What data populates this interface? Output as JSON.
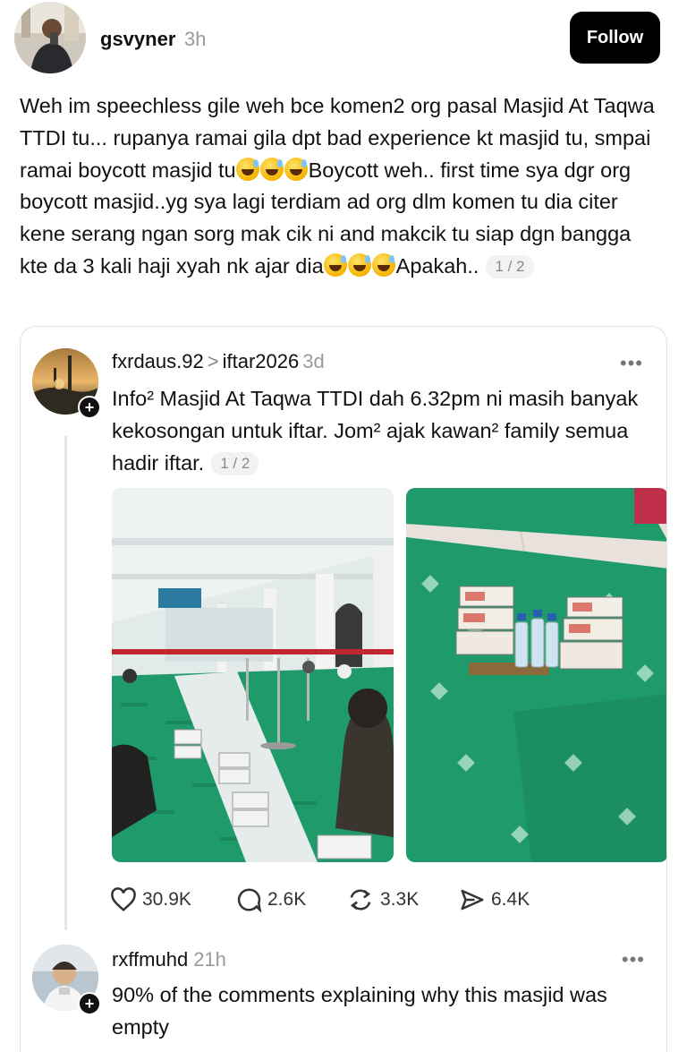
{
  "post": {
    "username": "gsvyner",
    "time": "3h",
    "follow_label": "Follow",
    "text_part1": "Weh im speechless gile weh bce komen2 org pasal Masjid At Taqwa TTDI tu... rupanya ramai gila dpt bad experience kt masjid tu, smpai ramai boycott masjid tu",
    "text_part2": "Boycott weh.. first time sya dgr org boycott masjid..yg sya lagi terdiam ad org dlm komen tu dia citer kene serang ngan sorg mak cik ni and makcik tu siap dgn bangga kte da 3 kali haji xyah nk ajar dia",
    "text_part3": "Apakah..",
    "page_indicator": "1 / 2",
    "emoji_name": "grinning-sweat-emoji"
  },
  "quoted": {
    "username": "fxrdaus.92",
    "arrow": ">",
    "topic": "iftar2026",
    "time": "3d",
    "more": "•••",
    "text": "Info² Masjid At Taqwa TTDI dah 6.32pm ni masih banyak kekosongan untuk iftar. Jom² ajak kawan² family semua hadir iftar.",
    "page_indicator": "1 / 2",
    "photos": [
      "mosque-interior-photo",
      "food-packs-on-mat-photo"
    ],
    "actions": {
      "likes": "30.9K",
      "comments": "2.6K",
      "reposts": "3.3K",
      "shares": "6.4K"
    }
  },
  "reply": {
    "username": "rxffmuhd",
    "time": "21h",
    "more": "•••",
    "text": "90% of the comments explaining why this masjid was empty"
  },
  "colors": {
    "follow_bg": "#000000",
    "muted": "#9a9a9a",
    "mat_green": "#1f9a6a"
  }
}
